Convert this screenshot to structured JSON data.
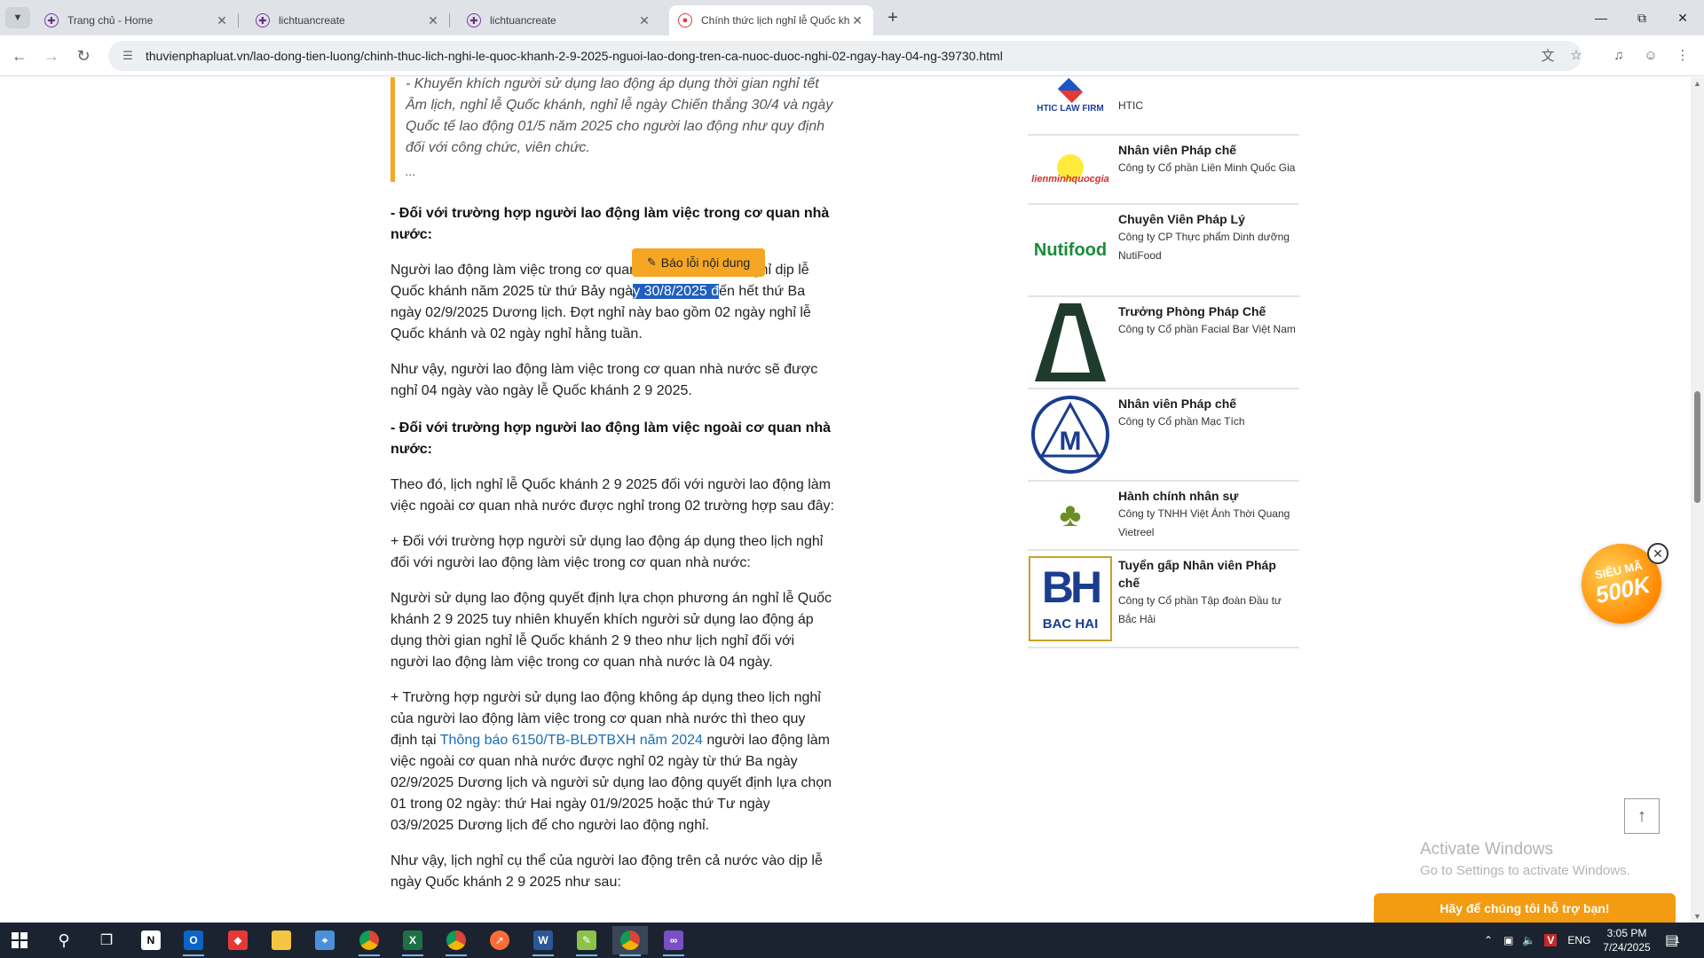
{
  "browser": {
    "tabs": [
      {
        "title": "Trang chủ - Home",
        "active": false
      },
      {
        "title": "lichtuancreate",
        "active": false
      },
      {
        "title": "lichtuancreate",
        "active": false
      },
      {
        "title": "Chính thức lịch nghỉ lễ Quốc kh",
        "active": true
      }
    ],
    "url": "thuvienphapluat.vn/lao-dong-tien-luong/chinh-thuc-lich-nghi-le-quoc-khanh-2-9-2025-nguoi-lao-dong-tren-ca-nuoc-duoc-nghi-02-ngay-hay-04-ng-39730.html"
  },
  "article": {
    "quote_text": "- Khuyến khích người sử dụng lao động áp dụng thời gian nghỉ tết Âm lịch, nghỉ lễ Quốc khánh, nghỉ lễ ngày Chiến thắng 30/4 và ngày Quốc tế lao động 01/5 năm 2025 cho người lao động như quy định đối với công chức, viên chức.",
    "quote_ellipsis": "...",
    "heading1": "- Đối với trường hợp người lao động làm việc trong cơ quan nhà nước:",
    "p1_before": "Người lao động làm việc trong cơ quan nhà nước được nghỉ dịp lễ Quốc khánh năm 2025 từ thứ Bảy ngà",
    "p1_selected": "y 30/8/2025 đ",
    "p1_after": "ến hết thứ Ba ngày 02/9/2025 Dương lịch. Đợt nghỉ này bao gồm 02 ngày nghỉ lễ Quốc khánh và 02 ngày nghỉ hằng tuần.",
    "p2": "Như vậy, người lao động làm việc trong cơ quan nhà nước sẽ được nghỉ 04 ngày vào ngày lễ Quốc khánh 2 9 2025.",
    "heading2": "- Đối với trường hợp người lao động làm việc ngoài cơ quan nhà nước:",
    "p3": "Theo đó, lịch nghỉ lễ Quốc khánh 2 9 2025 đối với người lao động làm việc ngoài cơ quan nhà nước được nghỉ trong 02 trường hợp sau đây:",
    "p4": "+ Đối với trường hợp người sử dụng lao động áp dụng theo lịch nghỉ đối với người lao động làm việc trong cơ quan nhà nước:",
    "p5": "Người sử dụng lao động quyết định lựa chọn phương án nghỉ lễ Quốc khánh 2 9 2025 tuy nhiên khuyến khích người sử dụng lao động áp dụng thời gian nghỉ lễ Quốc khánh 2 9 theo như lịch nghỉ đối với người lao động làm việc trong cơ quan nhà nước là 04 ngày.",
    "p6_before": "+ Trường hợp người sử dụng lao động không áp dụng theo lịch nghỉ của người lao động làm việc trong cơ quan nhà nước thì theo quy định tại ",
    "p6_link": "Thông báo 6150/TB-BLĐTBXH năm 2024",
    "p6_after": " người lao động làm việc ngoài cơ quan nhà nước được nghỉ 02 ngày từ thứ Ba ngày 02/9/2025 Dương lịch và người sử dụng lao động quyết định lựa chọn 01 trong 02 ngày: thứ Hai ngày 01/9/2025 hoặc thứ Tư ngày 03/9/2025 Dương lịch để cho người lao động nghỉ.",
    "p7": "Như vậy, lịch nghỉ cụ thể của người lao động trên cả nước vào dịp lễ ngày Quốc khánh 2 9 2025 như sau:",
    "report_button": "Báo lỗi nội dung"
  },
  "jobs": [
    {
      "title": "",
      "company": "HTIC",
      "logo_text": "HTIC LAW FIRM",
      "logo": "htic-logo"
    },
    {
      "title": "Nhân viên Pháp chế",
      "company": "Công ty Cổ phần Liên Minh Quốc Gia",
      "logo_text": "lienminhquocgia",
      "logo": "lienminh-logo"
    },
    {
      "title": "Chuyên Viên Pháp Lý",
      "company": "Công ty CP Thực phẩm Dinh dưỡng NutiFood",
      "logo_text": "Nutifood",
      "logo": "nutifood-logo"
    },
    {
      "title": "Trưởng Phòng Pháp Chế",
      "company": "Công ty Cổ phần Facial Bar Việt Nam",
      "logo_text": "",
      "logo": "facialbar-logo"
    },
    {
      "title": "Nhân viên Pháp chế",
      "company": "Công ty Cổ phần Mạc Tích",
      "logo_text": "M",
      "logo": "mactich-logo"
    },
    {
      "title": "Hành chính nhân sự",
      "company": "Công ty TNHH Việt Ánh Thời Quang Vietreel",
      "logo_text": "",
      "logo": "clover-logo"
    },
    {
      "title": "Tuyển gấp Nhân viên Pháp chế",
      "company": "Công ty Cổ phần Tập đoàn Đầu tư Bắc Hải",
      "logo_text": "BH",
      "logo_sub": "BAC HAI",
      "logo": "bachai-logo"
    }
  ],
  "promo": {
    "line1": "SIÊU MÃ",
    "line2": "500K"
  },
  "support_bar": "Hãy để chúng tôi hỗ trợ bạn!",
  "watermark": {
    "line1": "Activate Windows",
    "line2": "Go to Settings to activate Windows."
  },
  "taskbar": {
    "lang": "ENG",
    "time": "3:05 PM",
    "date": "7/24/2025",
    "notif_count": "1"
  },
  "colors": {
    "accent": "#f5a623",
    "link": "#1a6fb5",
    "selection": "#1f5fbf"
  }
}
